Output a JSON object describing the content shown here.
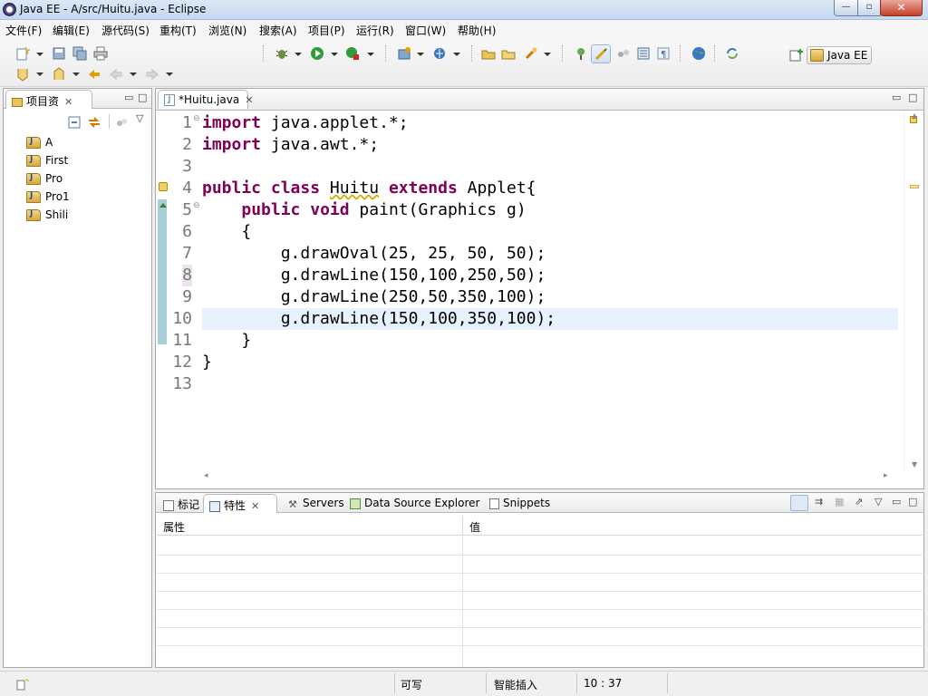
{
  "window": {
    "title": "Java EE  - A/src/Huitu.java  - Eclipse",
    "buttons": {
      "minimize": "—",
      "maximize": "▫",
      "close": "✕"
    }
  },
  "menubar": {
    "items": [
      {
        "label": "文件(F)"
      },
      {
        "label": "编辑(E)"
      },
      {
        "label": "源代码(S)"
      },
      {
        "label": "重构(T)"
      },
      {
        "label": "浏览(N)"
      },
      {
        "label": "搜索(A)"
      },
      {
        "label": "项目(P)"
      },
      {
        "label": "运行(R)"
      },
      {
        "label": "窗口(W)"
      },
      {
        "label": "帮助(H)"
      }
    ]
  },
  "perspective": {
    "label": "Java EE",
    "icon": "java-ee-perspective-icon"
  },
  "explorer": {
    "tab_label": "项目资",
    "projects": [
      {
        "label": "A"
      },
      {
        "label": "First"
      },
      {
        "label": "Pro"
      },
      {
        "label": "Pro1"
      },
      {
        "label": "Shili"
      }
    ]
  },
  "editor": {
    "tab_label": "*Huitu.java",
    "lines": [
      {
        "n": "1",
        "parts": [
          {
            "t": "import",
            "k": true
          },
          {
            "t": " java.applet.*;"
          }
        ]
      },
      {
        "n": "2",
        "parts": [
          {
            "t": "import",
            "k": true
          },
          {
            "t": " java.awt.*;"
          }
        ]
      },
      {
        "n": "3",
        "parts": []
      },
      {
        "n": "4",
        "parts": [
          {
            "t": "public",
            "k": true
          },
          {
            "t": " "
          },
          {
            "t": "class",
            "k": true
          },
          {
            "t": " "
          },
          {
            "t": "Huitu",
            "w": true
          },
          {
            "t": " "
          },
          {
            "t": "extends",
            "k": true
          },
          {
            "t": " Applet{"
          }
        ]
      },
      {
        "n": "5",
        "parts": [
          {
            "t": "    "
          },
          {
            "t": "public",
            "k": true
          },
          {
            "t": " "
          },
          {
            "t": "void",
            "k": true
          },
          {
            "t": " paint(Graphics g)"
          }
        ]
      },
      {
        "n": "6",
        "parts": [
          {
            "t": "    {"
          }
        ]
      },
      {
        "n": "7",
        "parts": [
          {
            "t": "        g.drawOval(25, 25, 50, 50);"
          }
        ]
      },
      {
        "n": "8",
        "parts": [
          {
            "t": "        g.drawLine(150,100,250,50);"
          }
        ]
      },
      {
        "n": "9",
        "parts": [
          {
            "t": "        g.drawLine(250,50,350,100);"
          }
        ]
      },
      {
        "n": "10",
        "parts": [
          {
            "t": "        g.drawLine(150,100,350,100);"
          }
        ]
      },
      {
        "n": "11",
        "parts": [
          {
            "t": "    }"
          }
        ]
      },
      {
        "n": "12",
        "parts": [
          {
            "t": "}"
          }
        ]
      },
      {
        "n": "13",
        "parts": []
      }
    ],
    "colors": {
      "keyword": "#7f0055",
      "current_line": "#e8f2fe",
      "line_number": "#787878"
    }
  },
  "bottom_panel": {
    "tabs": [
      {
        "label": "标记"
      },
      {
        "label": "特性"
      },
      {
        "label": "Servers"
      },
      {
        "label": "Data Source Explorer"
      },
      {
        "label": "Snippets"
      }
    ],
    "columns": [
      {
        "label": "属性"
      },
      {
        "label": "值"
      }
    ]
  },
  "statusbar": {
    "writable": "可写",
    "insert_mode": "智能插入",
    "cursor_position": "10 : 37"
  }
}
